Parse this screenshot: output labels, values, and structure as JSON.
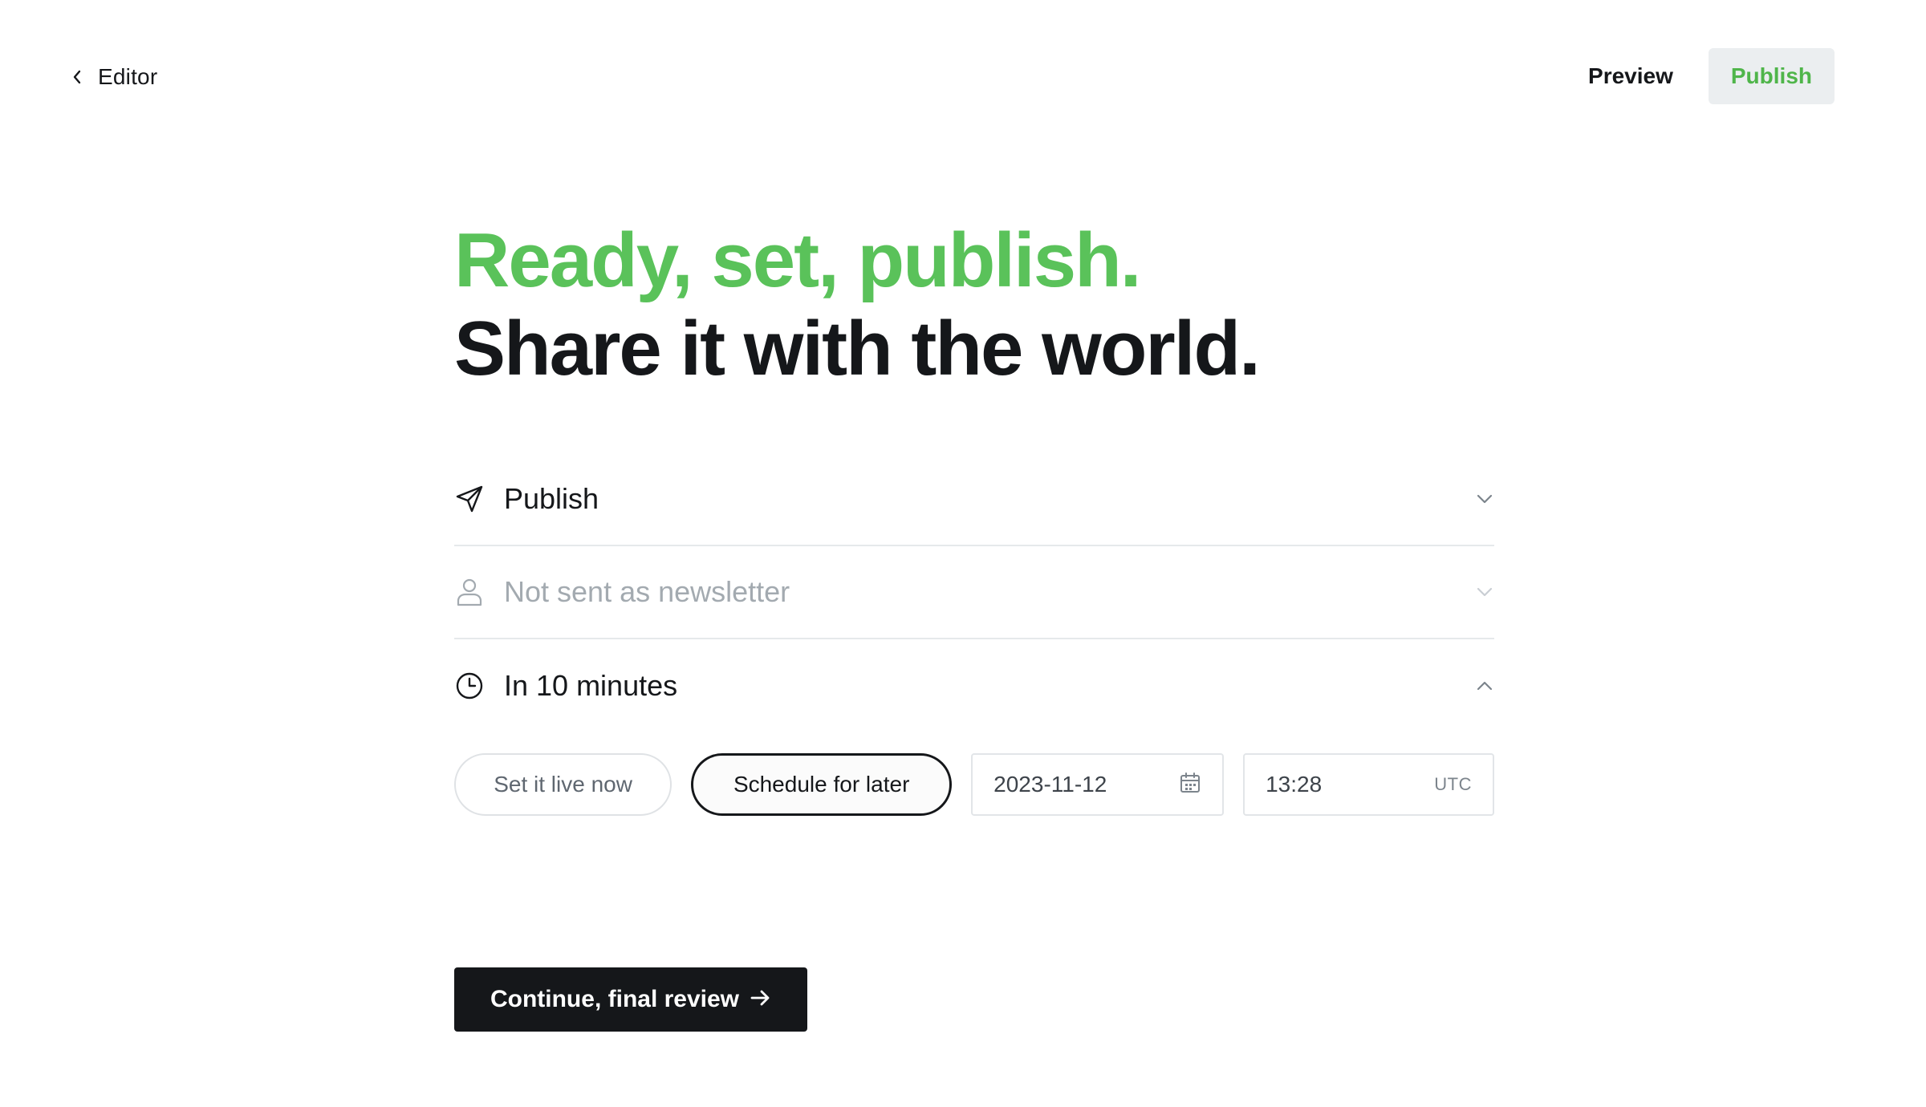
{
  "nav": {
    "back_label": "Editor",
    "preview_label": "Preview",
    "publish_label": "Publish"
  },
  "headline": {
    "line1": "Ready, set, publish.",
    "line2": "Share it with the world."
  },
  "settings": {
    "publish_type": {
      "label": "Publish",
      "icon": "send-icon"
    },
    "newsletter": {
      "label": "Not sent as newsletter",
      "icon": "user-icon"
    },
    "schedule": {
      "label": "In 10 minutes",
      "icon": "clock-icon"
    }
  },
  "schedule_options": {
    "now_label": "Set it live now",
    "later_label": "Schedule for later",
    "selected": "later",
    "date_value": "2023-11-12",
    "time_value": "13:28",
    "timezone": "UTC"
  },
  "continue_label": "Continue, final review",
  "colors": {
    "accent_green": "#5ac25a",
    "dark": "#15171a",
    "muted": "#a3aab0"
  }
}
